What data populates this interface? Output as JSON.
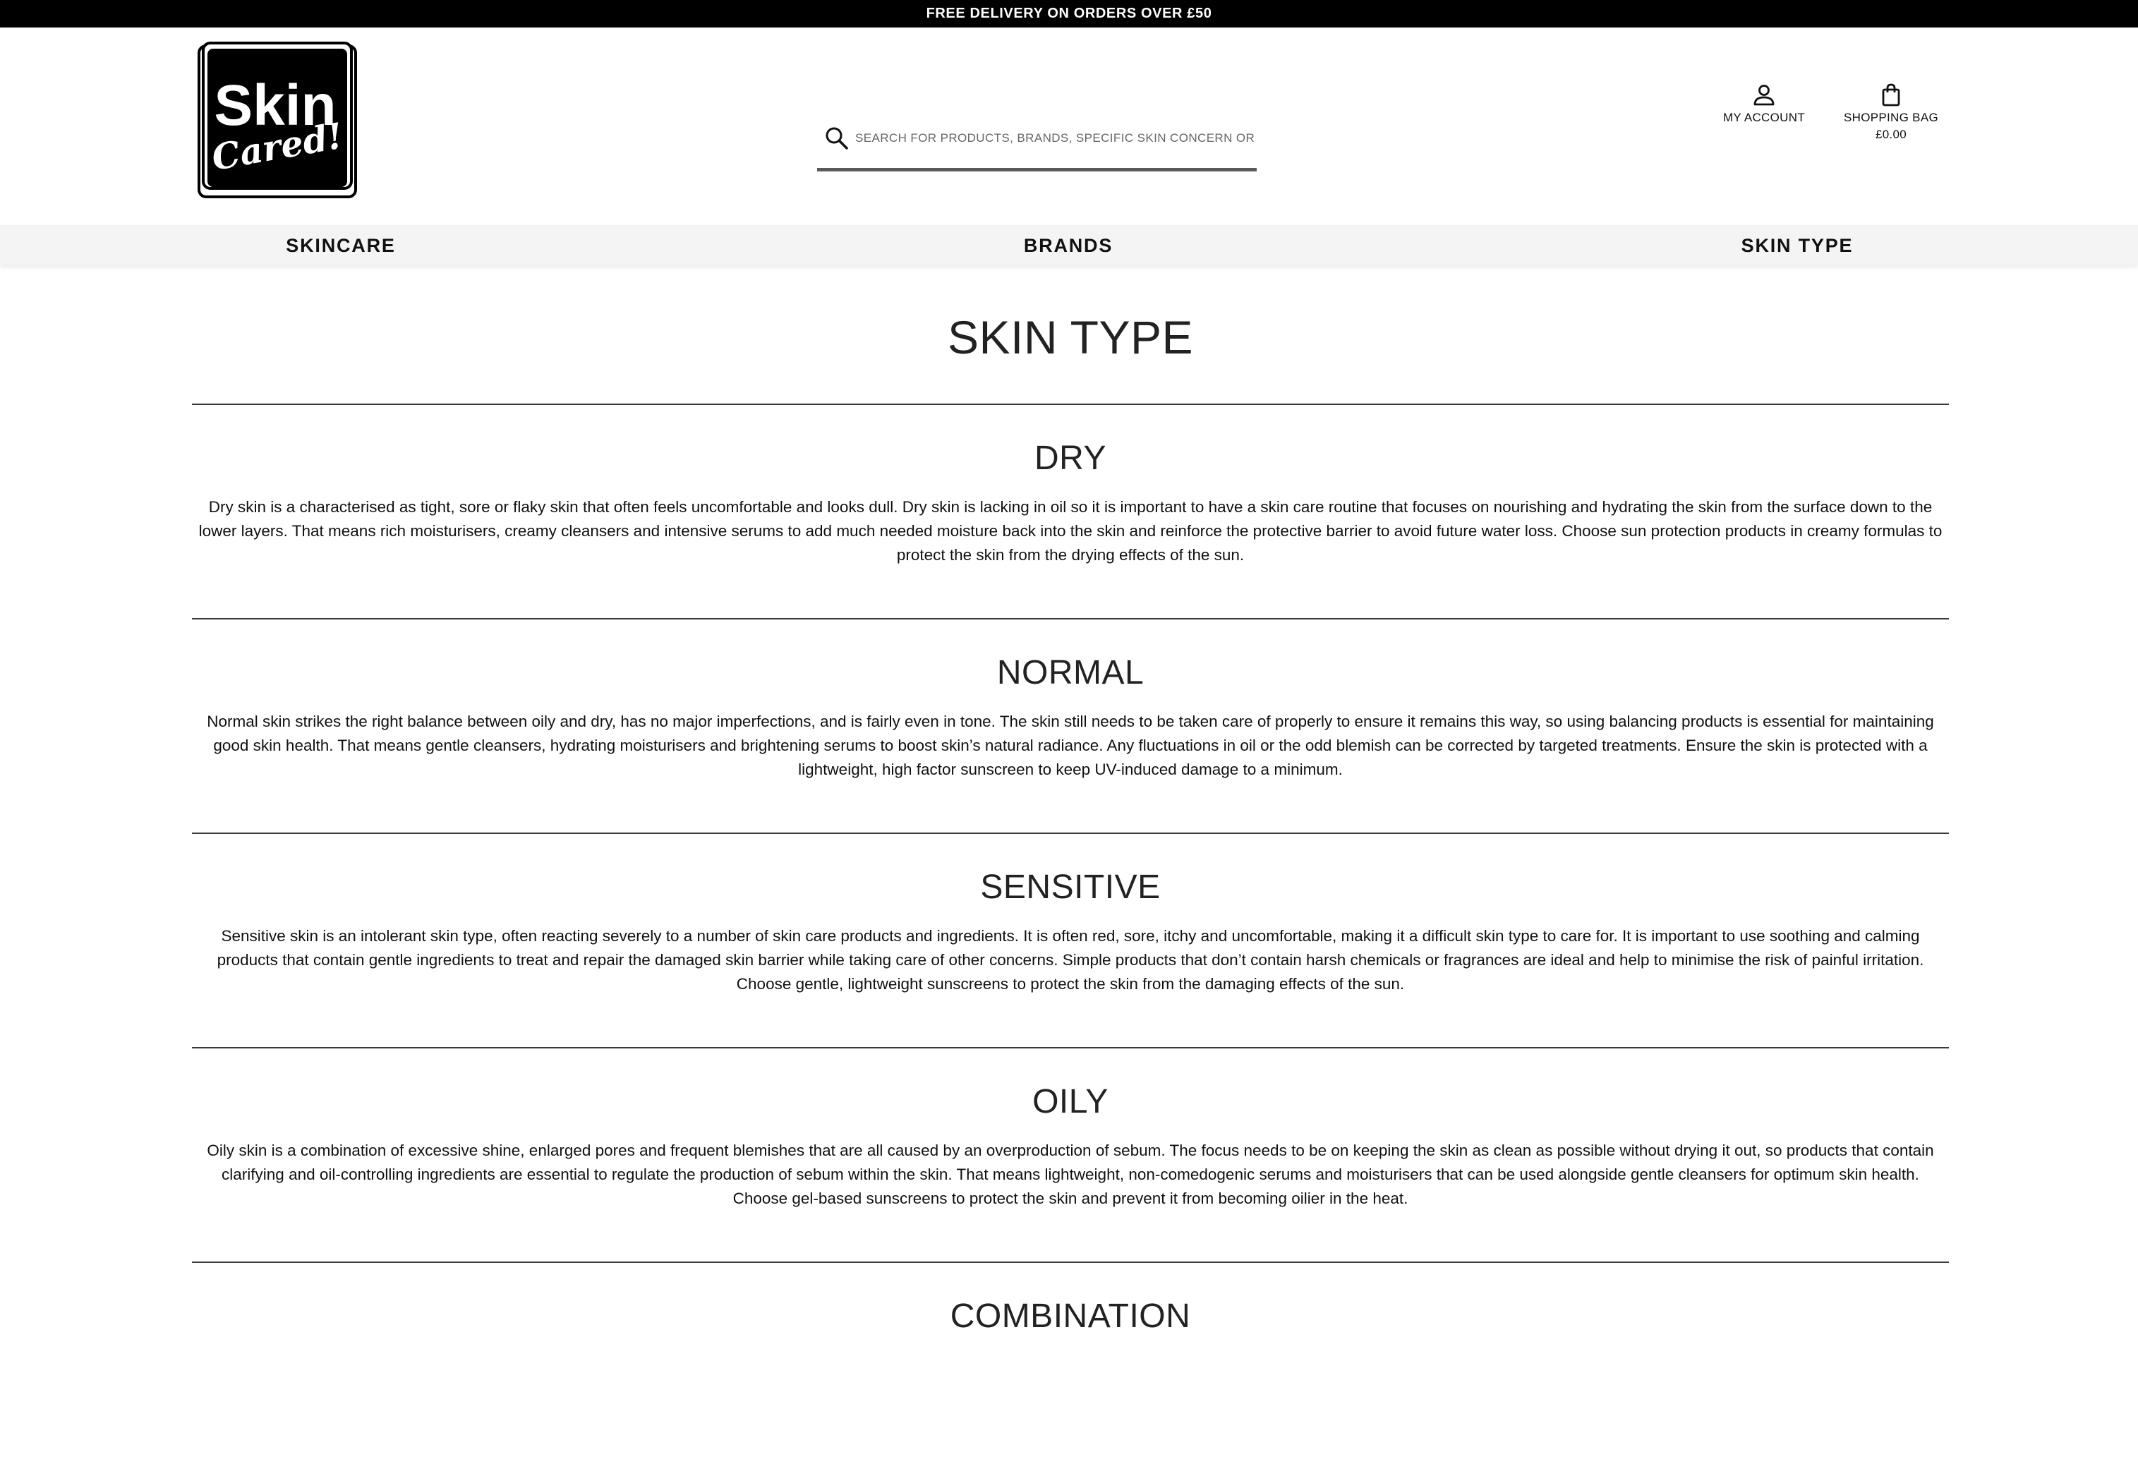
{
  "promo_banner": "FREE DELIVERY ON ORDERS OVER £50",
  "logo": {
    "text_main": "Skin",
    "text_script": "Cared!"
  },
  "search": {
    "placeholder": "SEARCH FOR PRODUCTS, BRANDS, SPECIFIC SKIN CONCERN OR TYPE"
  },
  "header": {
    "account_label": "MY ACCOUNT",
    "bag_label": "SHOPPING BAG",
    "bag_total": "£0.00"
  },
  "nav": {
    "items": [
      {
        "label": "SKINCARE"
      },
      {
        "label": "BRANDS"
      },
      {
        "label": "SKIN TYPE"
      }
    ]
  },
  "page": {
    "title": "SKIN TYPE",
    "sections": [
      {
        "heading": "DRY",
        "body": "Dry skin is a characterised as tight, sore or flaky skin that often feels uncomfortable and looks dull. Dry skin is lacking in oil so it is important to have a skin care routine that focuses on nourishing and hydrating the skin from the surface down to the lower layers. That means rich moisturisers, creamy cleansers and intensive serums to add much needed moisture back into the skin and reinforce the protective barrier to avoid future water loss. Choose sun protection products in creamy formulas to protect the skin from the drying effects of the sun."
      },
      {
        "heading": "NORMAL",
        "body": "Normal skin strikes the right balance between oily and dry, has no major imperfections, and is fairly even in tone. The skin still needs to be taken care of properly to ensure it remains this way, so using balancing products is essential for maintaining good skin health. That means gentle cleansers, hydrating moisturisers and brightening serums to boost skin’s natural radiance. Any fluctuations in oil or the odd blemish can be corrected by targeted treatments. Ensure the skin is protected with a lightweight, high factor sunscreen to keep UV-induced damage to a minimum."
      },
      {
        "heading": "SENSITIVE",
        "body": "Sensitive skin is an intolerant skin type, often reacting severely to a number of skin care products and ingredients. It is often red, sore, itchy and uncomfortable, making it a difficult skin type to care for. It is important to use soothing and calming products that contain gentle ingredients to treat and repair the damaged skin barrier while taking care of other concerns. Simple products that don’t contain harsh chemicals or fragrances are ideal and help to minimise the risk of painful irritation. Choose gentle, lightweight sunscreens to protect the skin from the damaging effects of the sun."
      },
      {
        "heading": "OILY",
        "body": "Oily skin is a combination of excessive shine, enlarged pores and frequent blemishes that are all caused by an overproduction of sebum. The focus needs to be on keeping the skin as clean as possible without drying it out, so products that contain clarifying and oil-controlling ingredients are essential to regulate the production of sebum within the skin. That means lightweight, non-comedogenic serums and moisturisers that can be used alongside gentle cleansers for optimum skin health. Choose gel-based sunscreens to protect the skin and prevent it from becoming oilier in the heat."
      },
      {
        "heading": "COMBINATION",
        "body": ""
      }
    ]
  }
}
